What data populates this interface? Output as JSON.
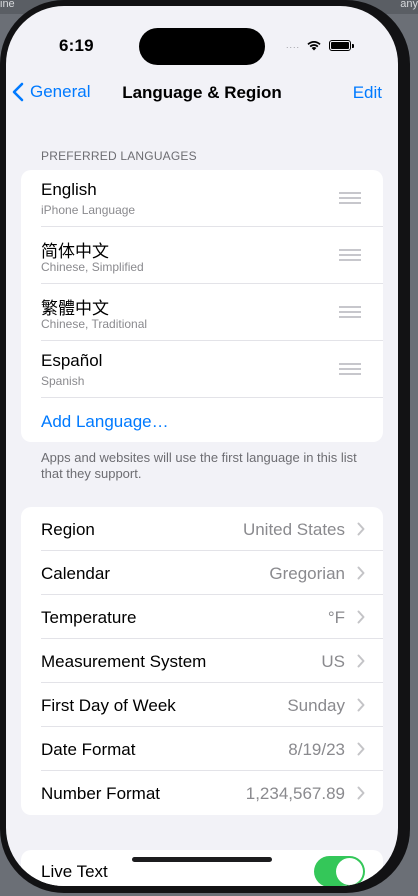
{
  "background": {
    "left_text": "ine",
    "right_text": "any"
  },
  "status_bar": {
    "time": "6:19",
    "signal": "....",
    "wifi_icon": "wifi-icon",
    "battery_icon": "battery-icon"
  },
  "nav": {
    "back_label": "General",
    "title": "Language & Region",
    "edit_label": "Edit"
  },
  "preferred_languages": {
    "header": "PREFERRED LANGUAGES",
    "items": [
      {
        "title": "English",
        "subtitle": "iPhone Language"
      },
      {
        "title": "简体中文",
        "subtitle": "Chinese, Simplified"
      },
      {
        "title": "繁體中文",
        "subtitle": "Chinese, Traditional"
      },
      {
        "title": "Español",
        "subtitle": "Spanish"
      }
    ],
    "add_label": "Add Language…",
    "footer": "Apps and websites will use the first language in this list that they support."
  },
  "settings": [
    {
      "label": "Region",
      "value": "United States"
    },
    {
      "label": "Calendar",
      "value": "Gregorian"
    },
    {
      "label": "Temperature",
      "value": "°F"
    },
    {
      "label": "Measurement System",
      "value": "US"
    },
    {
      "label": "First Day of Week",
      "value": "Sunday"
    },
    {
      "label": "Date Format",
      "value": "8/19/23"
    },
    {
      "label": "Number Format",
      "value": "1,234,567.89"
    }
  ],
  "live_text": {
    "label": "Live Text",
    "enabled": true
  },
  "colors": {
    "accent": "#007aff",
    "toggle_on": "#34c759",
    "background": "#f2f2f7"
  }
}
